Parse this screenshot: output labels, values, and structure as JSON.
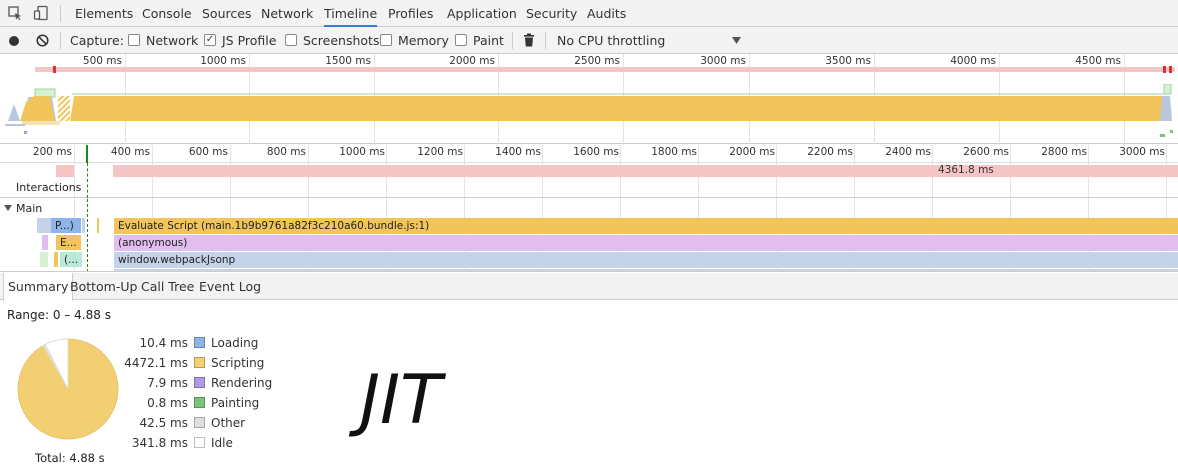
{
  "tabs": [
    "Elements",
    "Console",
    "Sources",
    "Network",
    "Timeline",
    "Profiles",
    "Application",
    "Security",
    "Audits"
  ],
  "active_tab": "Timeline",
  "toolbar": {
    "capture_label": "Capture:",
    "options": [
      {
        "label": "Network",
        "checked": false
      },
      {
        "label": "JS Profile",
        "checked": true
      },
      {
        "label": "Screenshots",
        "checked": false
      },
      {
        "label": "Memory",
        "checked": false
      },
      {
        "label": "Paint",
        "checked": false
      }
    ],
    "throttling": "No CPU throttling"
  },
  "overview_ticks": [
    "500 ms",
    "1000 ms",
    "1500 ms",
    "2000 ms",
    "2500 ms",
    "3000 ms",
    "3500 ms",
    "4000 ms",
    "4500 ms"
  ],
  "detail_ticks": [
    "200 ms",
    "400 ms",
    "600 ms",
    "800 ms",
    "1000 ms",
    "1200 ms",
    "1400 ms",
    "1600 ms",
    "1800 ms",
    "2000 ms",
    "2200 ms",
    "2400 ms",
    "2600 ms",
    "2800 ms",
    "3000 ms"
  ],
  "interactions_label": "Interactions",
  "interaction_duration": "4361.8 ms",
  "main_label": "Main",
  "flame_bars": [
    {
      "label": "Evaluate Script (main.1b9b9761a82f3c210a60.bundle.js:1)",
      "color": "#f2c55c"
    },
    {
      "label": "(anonymous)",
      "color": "#e0bfee"
    },
    {
      "label": "window.webpackJsonp",
      "color": "#c5d3ea"
    }
  ],
  "small_bars": [
    "P...)",
    "E...",
    "(..."
  ],
  "bottom_tabs": [
    "Summary",
    "Bottom-Up",
    "Call Tree",
    "Event Log"
  ],
  "active_bottom_tab": "Summary",
  "summary": {
    "range": "Range: 0 – 4.88 s",
    "total": "Total: 4.88 s",
    "rows": [
      {
        "value": "10.4 ms",
        "name": "Loading",
        "color": "#8fb4e8"
      },
      {
        "value": "4472.1 ms",
        "name": "Scripting",
        "color": "#f2cf73"
      },
      {
        "value": "7.9 ms",
        "name": "Rendering",
        "color": "#af98ea"
      },
      {
        "value": "0.8 ms",
        "name": "Painting",
        "color": "#7bc27b"
      },
      {
        "value": "42.5 ms",
        "name": "Other",
        "color": "#dedede"
      },
      {
        "value": "341.8 ms",
        "name": "Idle",
        "color": "#ffffff"
      }
    ]
  },
  "annotation": "JIT"
}
